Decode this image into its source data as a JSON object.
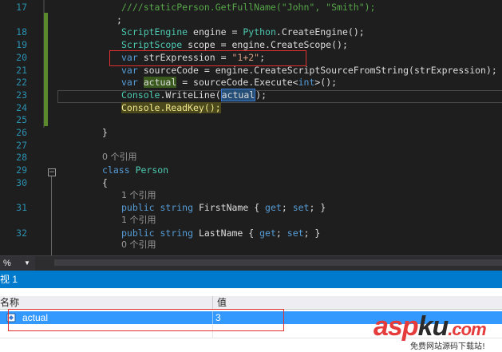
{
  "editor": {
    "lines": [
      {
        "num": "17",
        "parts": [
          {
            "t": "////staticPerson.GetFullName(\"John\", \"Smith\");",
            "c": "cm"
          }
        ]
      },
      {
        "num": "",
        "parts": [
          {
            "t": ";",
            "c": ""
          }
        ]
      },
      {
        "num": "18",
        "parts": [
          {
            "t": "ScriptEngine",
            "c": "ty"
          },
          {
            "t": " engine = ",
            "c": ""
          },
          {
            "t": "Python",
            "c": "ty"
          },
          {
            "t": ".CreateEngine();",
            "c": ""
          }
        ]
      },
      {
        "num": "19",
        "parts": [
          {
            "t": "ScriptScope",
            "c": "ty"
          },
          {
            "t": " scope = engine.CreateScope();",
            "c": ""
          }
        ]
      },
      {
        "num": "20",
        "parts": [
          {
            "t": "var",
            "c": "kw"
          },
          {
            "t": " strExpression = ",
            "c": ""
          },
          {
            "t": "\"1+2\"",
            "c": "str"
          },
          {
            "t": ";",
            "c": ""
          }
        ]
      },
      {
        "num": "21",
        "parts": [
          {
            "t": "var",
            "c": "kw"
          },
          {
            "t": " sourceCode = engine.CreateScriptSourceFromString(strExpression);",
            "c": ""
          }
        ]
      },
      {
        "num": "22",
        "parts": [
          {
            "t": "var",
            "c": "kw"
          },
          {
            "t": " ",
            "c": ""
          },
          {
            "t": "actual",
            "c": "hl-var"
          },
          {
            "t": " = sourceCode.Execute<",
            "c": ""
          },
          {
            "t": "int",
            "c": "kw"
          },
          {
            "t": ">();",
            "c": ""
          }
        ]
      },
      {
        "num": "23",
        "parts": [
          {
            "t": "Console",
            "c": "ty"
          },
          {
            "t": ".WriteLine(",
            "c": ""
          },
          {
            "t": "actual",
            "c": "hl-ref"
          },
          {
            "t": ");",
            "c": ""
          }
        ]
      },
      {
        "num": "24",
        "parts": [
          {
            "t": "Console.ReadKey();",
            "c": "hl-readkey"
          }
        ]
      },
      {
        "num": "25",
        "parts": []
      },
      {
        "num": "26",
        "parts": [
          {
            "t": "}",
            "c": ""
          }
        ]
      },
      {
        "num": "27",
        "parts": []
      },
      {
        "num": "28",
        "ref": "0 个引用"
      },
      {
        "num": "29",
        "parts": [
          {
            "t": "class",
            "c": "kw"
          },
          {
            "t": " ",
            "c": ""
          },
          {
            "t": "Person",
            "c": "ty"
          }
        ]
      },
      {
        "num": "30",
        "parts": [
          {
            "t": "{",
            "c": ""
          }
        ]
      },
      {
        "num": "",
        "ref": "1 个引用"
      },
      {
        "num": "31",
        "parts": [
          {
            "t": "public",
            "c": "kw"
          },
          {
            "t": " ",
            "c": ""
          },
          {
            "t": "string",
            "c": "kw"
          },
          {
            "t": " FirstName { ",
            "c": ""
          },
          {
            "t": "get",
            "c": "kw"
          },
          {
            "t": "; ",
            "c": ""
          },
          {
            "t": "set",
            "c": "kw"
          },
          {
            "t": "; }",
            "c": ""
          }
        ]
      },
      {
        "num": "",
        "ref": "1 个引用"
      },
      {
        "num": "32",
        "parts": [
          {
            "t": "public",
            "c": "kw"
          },
          {
            "t": " ",
            "c": ""
          },
          {
            "t": "string",
            "c": "kw"
          },
          {
            "t": " LastName { ",
            "c": ""
          },
          {
            "t": "get",
            "c": "kw"
          },
          {
            "t": "; ",
            "c": ""
          },
          {
            "t": "set",
            "c": "kw"
          },
          {
            "t": "; }",
            "c": ""
          }
        ]
      },
      {
        "num": "",
        "ref": "0 个引用"
      }
    ]
  },
  "zoom": {
    "value": "%"
  },
  "watch": {
    "title": "视 1",
    "col_name": "名称",
    "col_value": "值",
    "rows": [
      {
        "name": "actual",
        "value": "3"
      }
    ]
  },
  "watermark": {
    "logo_a": "asp",
    "logo_b": "ku",
    "logo_c": ".com",
    "sub": "免费网站源码下载站!"
  },
  "colors": {
    "accent": "#007acc",
    "selection": "#3399ff",
    "redbox": "#e03030"
  }
}
